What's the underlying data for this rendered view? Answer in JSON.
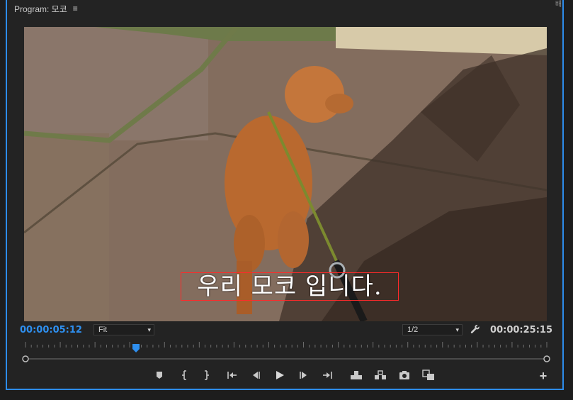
{
  "panel": {
    "title": "Program: 모코",
    "menu_icon": "hamburger-menu-icon",
    "edge_fragment": "배"
  },
  "monitor": {
    "caption": "우리 모코 입니다."
  },
  "info": {
    "current_timecode": "00:00:05:12",
    "zoom_value": "Fit",
    "resolution_value": "1/2",
    "duration_timecode": "00:00:25:15",
    "settings_icon": "wrench-icon"
  },
  "playhead": {
    "position_fraction": 0.212
  },
  "transport": {
    "buttons": [
      "add-marker-icon",
      "mark-in-icon",
      "mark-out-icon",
      "go-to-in-icon",
      "step-back-icon",
      "play-icon",
      "step-forward-icon",
      "go-to-out-icon",
      "lift-icon",
      "extract-icon",
      "export-frame-icon",
      "comparison-view-icon"
    ],
    "add_button": "+"
  },
  "colors": {
    "accent": "#2d8ceb",
    "timecode_blue": "#2e8fef",
    "caption_box": "#ff2a2a",
    "panel_bg": "#232323"
  }
}
